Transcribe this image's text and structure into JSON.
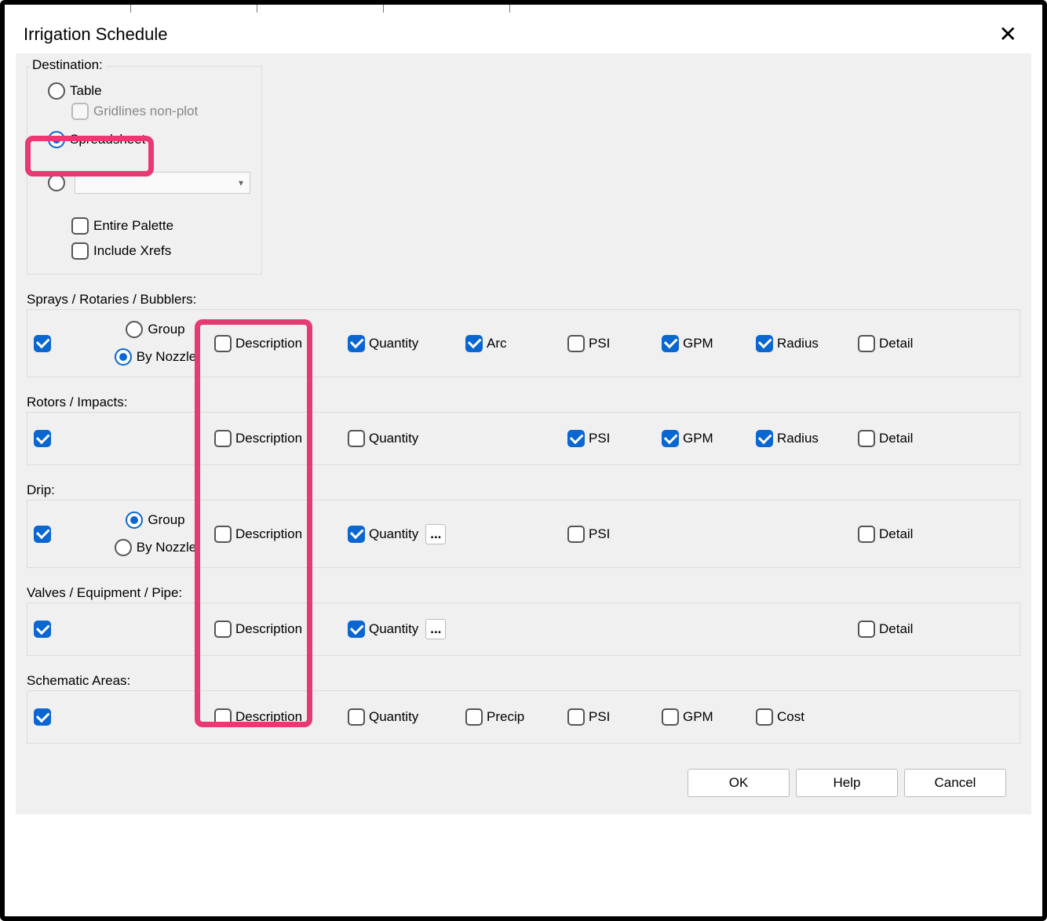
{
  "dialog": {
    "title": "Irrigation Schedule"
  },
  "destination": {
    "legend": "Destination:",
    "table": "Table",
    "gridlines": "Gridlines non-plot",
    "spreadsheet": "Spreadsheet",
    "entire_palette": "Entire Palette",
    "include_xrefs": "Include Xrefs"
  },
  "groupopt": {
    "group": "Group",
    "by_nozzle": "By Nozzle"
  },
  "cols": {
    "description": "Description",
    "quantity": "Quantity",
    "arc": "Arc",
    "psi": "PSI",
    "gpm": "GPM",
    "radius": "Radius",
    "detail": "Detail",
    "precip": "Precip",
    "cost": "Cost"
  },
  "sections": {
    "sprays": {
      "label": "Sprays / Rotaries / Bubblers:",
      "enabled": true,
      "group_sel": "by_nozzle",
      "description": false,
      "quantity": true,
      "arc": true,
      "psi": false,
      "gpm": true,
      "radius": true,
      "detail": false
    },
    "rotors": {
      "label": "Rotors / Impacts:",
      "enabled": true,
      "description": false,
      "quantity": false,
      "psi": true,
      "gpm": true,
      "radius": true,
      "detail": false
    },
    "drip": {
      "label": "Drip:",
      "enabled": true,
      "group_sel": "group",
      "description": false,
      "quantity": true,
      "psi": false,
      "detail": false
    },
    "valves": {
      "label": "Valves / Equipment / Pipe:",
      "enabled": true,
      "description": false,
      "quantity": true,
      "detail": false
    },
    "schematic": {
      "label": "Schematic Areas:",
      "enabled": true,
      "description": false,
      "quantity": false,
      "precip": false,
      "psi": false,
      "gpm": false,
      "cost": false
    }
  },
  "buttons": {
    "ok": "OK",
    "help": "Help",
    "cancel": "Cancel",
    "ellipsis": "..."
  }
}
